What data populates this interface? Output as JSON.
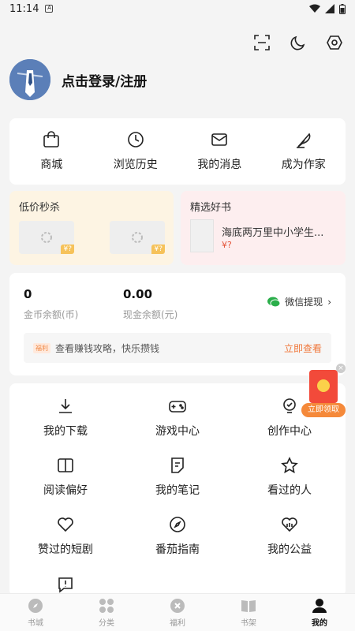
{
  "status": {
    "time": "11:14"
  },
  "profile": {
    "login_text": "点击登录/注册"
  },
  "quick": [
    {
      "label": "商城",
      "icon": "bag-icon"
    },
    {
      "label": "浏览历史",
      "icon": "clock-icon"
    },
    {
      "label": "我的消息",
      "icon": "mail-icon"
    },
    {
      "label": "成为作家",
      "icon": "feather-icon"
    }
  ],
  "flash": {
    "title": "低价秒杀",
    "price1": "¥?",
    "price2": "¥?"
  },
  "picks": {
    "title": "精选好书",
    "book_title": "海底两万里中小学生...",
    "book_price": "¥?"
  },
  "wallet": {
    "coins": "0",
    "coins_label": "金币余额(币)",
    "cash": "0.00",
    "cash_label": "现金余额(元)",
    "withdraw": "微信提现",
    "tip_badge": "福利",
    "tip_text": "查看赚钱攻略，快乐攒钱",
    "tip_action": "立即查看"
  },
  "redpack": {
    "label": "立即领取"
  },
  "grid": [
    {
      "label": "我的下载",
      "icon": "download-icon"
    },
    {
      "label": "游戏中心",
      "icon": "gamepad-icon"
    },
    {
      "label": "创作中心",
      "icon": "bulb-icon"
    },
    {
      "label": "阅读偏好",
      "icon": "book-open-icon"
    },
    {
      "label": "我的笔记",
      "icon": "note-icon"
    },
    {
      "label": "看过的人",
      "icon": "star-icon"
    },
    {
      "label": "赞过的短剧",
      "icon": "heart-icon"
    },
    {
      "label": "番茄指南",
      "icon": "compass-icon"
    },
    {
      "label": "我的公益",
      "icon": "charity-icon"
    },
    {
      "label": "",
      "icon": "feedback-icon"
    }
  ],
  "tabs": [
    {
      "label": "书城",
      "icon": "compass-tab-icon"
    },
    {
      "label": "分类",
      "icon": "grid-tab-icon"
    },
    {
      "label": "福利",
      "icon": "gift-tab-icon"
    },
    {
      "label": "书架",
      "icon": "bookshelf-tab-icon"
    },
    {
      "label": "我的",
      "icon": "person-tab-icon"
    }
  ],
  "colors": {
    "accent": "#f0783c",
    "red": "#f24a3a"
  }
}
